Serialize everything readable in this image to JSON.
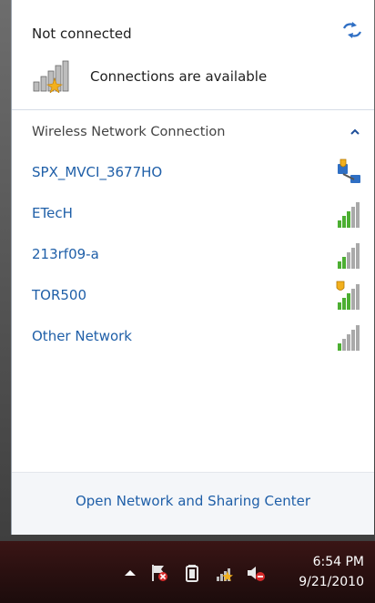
{
  "header": {
    "status": "Not connected",
    "availability": "Connections are available"
  },
  "section": {
    "label": "Wireless Network Connection"
  },
  "networks": [
    {
      "name": "SPX_MVCI_3677HO",
      "icon": "secured-network-icon"
    },
    {
      "name": "ETecH",
      "icon": "signal-strength-icon"
    },
    {
      "name": "213rf09-a",
      "icon": "signal-strength-icon"
    },
    {
      "name": "TOR500",
      "icon": "secured-signal-icon"
    },
    {
      "name": "Other Network",
      "icon": "signal-strength-icon"
    }
  ],
  "footer": {
    "link": "Open Network and Sharing Center"
  },
  "taskbar": {
    "time": "6:54 PM",
    "date": "9/21/2010"
  },
  "colors": {
    "link": "#1f5fa8",
    "signal_green": "#4caf32",
    "signal_gray": "#a9a9a9",
    "warning": "#f2b01e"
  }
}
